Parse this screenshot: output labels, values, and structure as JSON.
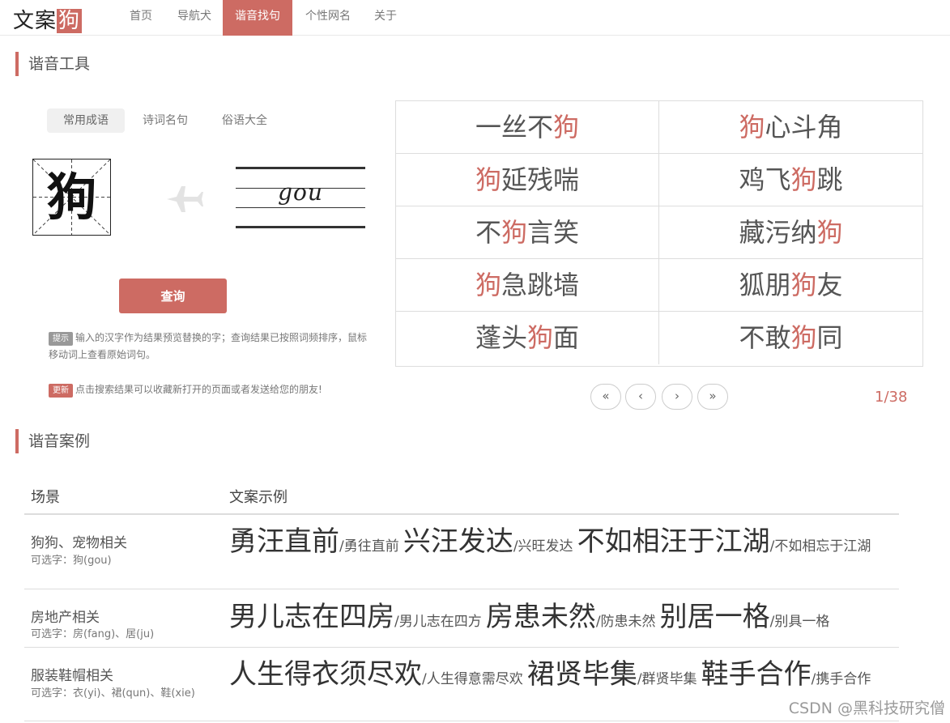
{
  "logo": {
    "left": "文案",
    "accent": "狗"
  },
  "nav": [
    "首页",
    "导航犬",
    "谐音找句",
    "个性网名",
    "关于"
  ],
  "section1_title": "谐音工具",
  "tabs": [
    "常用成语",
    "诗词名句",
    "俗语大全"
  ],
  "input_char": "狗",
  "pinyin": "gou",
  "query_button": "查询",
  "tip": {
    "badge": "提示",
    "text": "输入的汉字作为结果预览替换的字；查询结果已按照词频排序，鼠标移动词上查看原始词句。"
  },
  "update": {
    "badge": "更新",
    "text": "点击搜索结果可以收藏新打开的页面或者发送给您的朋友!"
  },
  "results": [
    {
      "pre": "一丝不",
      "hl": "狗",
      "post": ""
    },
    {
      "pre": "",
      "hl": "狗",
      "post": "心斗角"
    },
    {
      "pre": "",
      "hl": "狗",
      "post": "延残喘"
    },
    {
      "pre": "鸡飞",
      "hl": "狗",
      "post": "跳"
    },
    {
      "pre": "不",
      "hl": "狗",
      "post": "言笑"
    },
    {
      "pre": "藏污纳",
      "hl": "狗",
      "post": ""
    },
    {
      "pre": "",
      "hl": "狗",
      "post": "急跳墙"
    },
    {
      "pre": "狐朋",
      "hl": "狗",
      "post": "友"
    },
    {
      "pre": "蓬头",
      "hl": "狗",
      "post": "面"
    },
    {
      "pre": "不敢",
      "hl": "狗",
      "post": "同"
    }
  ],
  "pager": {
    "first": "«",
    "prev": "‹",
    "next": "›",
    "last": "»",
    "page": "1/38"
  },
  "section2_title": "谐音案例",
  "table_headers": {
    "scene": "场景",
    "example": "文案示例"
  },
  "cases": [
    {
      "scene": "狗狗、宠物相关",
      "options": "可选字：狗(gou)",
      "examples": [
        {
          "pre": "勇",
          "hl": "汪",
          "post": "直前",
          "orig": "/勇往直前"
        },
        {
          "pre": "兴",
          "hl": "汪",
          "post": "发达",
          "orig": "/兴旺发达"
        },
        {
          "pre": "不如相",
          "hl": "汪",
          "post": "于江湖",
          "orig": "/不如相忘于江湖"
        }
      ]
    },
    {
      "scene": "房地产相关",
      "options": "可选字：房(fang)、居(ju)",
      "examples": [
        {
          "pre": "男儿志在四",
          "hl": "房",
          "post": "",
          "orig": "/男儿志在四方"
        },
        {
          "pre": "",
          "hl": "房",
          "post": "患未然",
          "orig": "/防患未然"
        },
        {
          "pre": "别",
          "hl": "居",
          "post": "一格",
          "orig": "/别具一格"
        }
      ]
    },
    {
      "scene": "服装鞋帽相关",
      "options": "可选字：衣(yi)、裙(qun)、鞋(xie)",
      "examples": [
        {
          "pre": "人生得",
          "hl": "衣",
          "post": "须尽欢",
          "orig": "/人生得意需尽欢"
        },
        {
          "pre": "",
          "hl": "裙",
          "post": "贤毕集",
          "orig": "/群贤毕集"
        },
        {
          "pre": "",
          "hl": "鞋",
          "post": "手合作",
          "orig": "/携手合作"
        }
      ]
    }
  ],
  "watermark": "CSDN @黑科技研究僧",
  "colors": {
    "accent": "#cd6b63",
    "text": "#555555",
    "border": "#dddddd"
  }
}
